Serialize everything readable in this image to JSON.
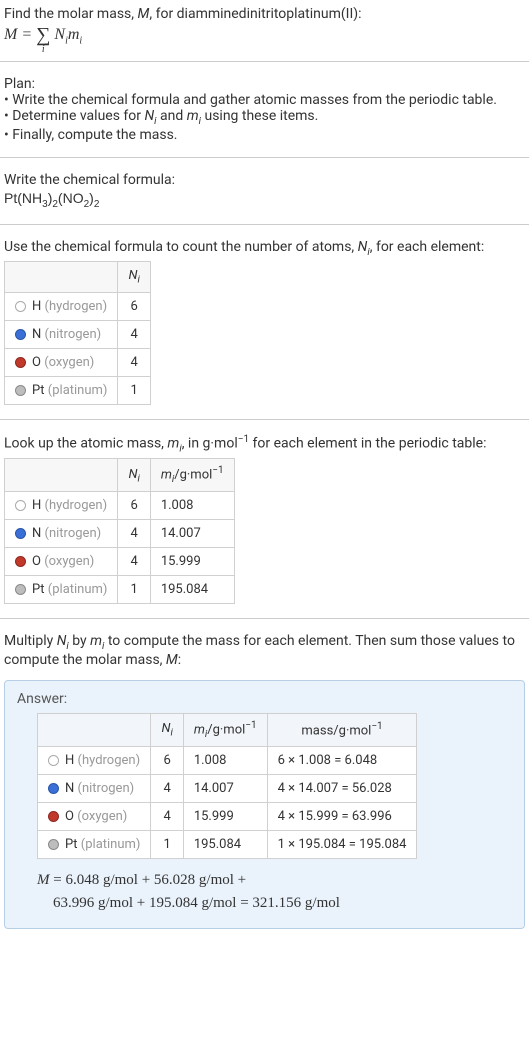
{
  "intro": {
    "line1_a": "Find the molar mass, ",
    "line1_b": "M",
    "line1_c": ", for diamminedinitritoplatinum(II):",
    "eq_left": "M = ",
    "eq_sigma": "∑",
    "eq_sub": "i",
    "eq_right_a": " N",
    "eq_right_b": "i",
    "eq_right_c": "m",
    "eq_right_d": "i"
  },
  "plan": {
    "heading": "Plan:",
    "b1": "• Write the chemical formula and gather atomic masses from the periodic table.",
    "b2_a": "• Determine values for ",
    "b2_n": "N",
    "b2_ni": "i",
    "b2_and": " and ",
    "b2_m": "m",
    "b2_mi": "i",
    "b2_end": " using these items.",
    "b3": "• Finally, compute the mass."
  },
  "chem": {
    "heading": "Write the chemical formula:",
    "formula_a": "Pt(NH",
    "formula_b": "3",
    "formula_c": ")",
    "formula_d": "2",
    "formula_e": "(NO",
    "formula_f": "2",
    "formula_g": ")",
    "formula_h": "2"
  },
  "count": {
    "heading_a": "Use the chemical formula to count the number of atoms, ",
    "heading_n": "N",
    "heading_ni": "i",
    "heading_b": ", for each element:",
    "col_n": "N",
    "col_ni": "i"
  },
  "elements": [
    {
      "color": "#ffffff",
      "border": "#aaaaaa",
      "sym": "H",
      "name": "(hydrogen)",
      "n": "6",
      "m": "1.008",
      "mass": "6 × 1.008 = 6.048"
    },
    {
      "color": "#3a6fd8",
      "border": "#2a56a8",
      "sym": "N",
      "name": "(nitrogen)",
      "n": "4",
      "m": "14.007",
      "mass": "4 × 14.007 = 56.028"
    },
    {
      "color": "#c0392b",
      "border": "#8e281f",
      "sym": "O",
      "name": "(oxygen)",
      "n": "4",
      "m": "15.999",
      "mass": "4 × 15.999 = 63.996"
    },
    {
      "color": "#bdbdbd",
      "border": "#8a8a8a",
      "sym": "Pt",
      "name": "(platinum)",
      "n": "1",
      "m": "195.084",
      "mass": "1 × 195.084 = 195.084"
    }
  ],
  "lookup": {
    "heading_a": "Look up the atomic mass, ",
    "heading_m": "m",
    "heading_mi": "i",
    "heading_b": ", in g·mol",
    "heading_exp": "−1",
    "heading_c": " for each element in the periodic table:",
    "col_m": "m",
    "col_mi": "i",
    "col_unit_a": "/g·mol",
    "col_unit_exp": "−1"
  },
  "multiply": {
    "heading_a": "Multiply ",
    "n": "N",
    "ni": "i",
    "by": " by ",
    "m": "m",
    "mi": "i",
    "rest": " to compute the mass for each element. Then sum those values to compute the molar mass, ",
    "M": "M",
    "colon": ":"
  },
  "answer": {
    "label": "Answer:",
    "col_mass_a": "mass/g·mol",
    "col_mass_exp": "−1",
    "final_a": "M",
    "final_eq": " = 6.048 g/mol + 56.028 g/mol + ",
    "final_line2": "63.996 g/mol + 195.084 g/mol = 321.156 g/mol"
  }
}
